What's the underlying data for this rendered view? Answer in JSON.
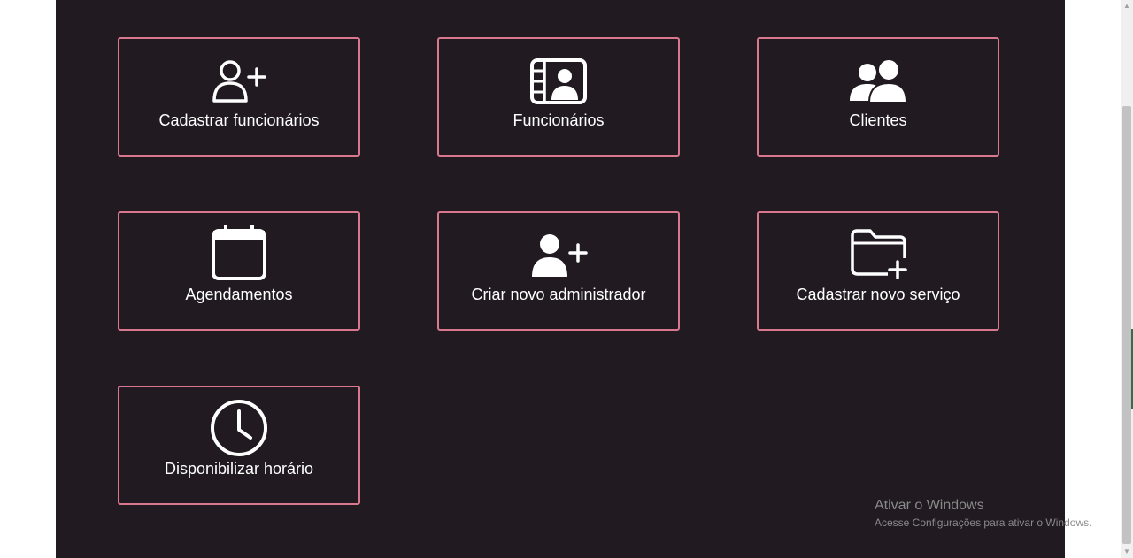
{
  "cards": [
    {
      "label": "Cadastrar funcionários",
      "icon": "user-plus-outline-icon"
    },
    {
      "label": "Funcionários",
      "icon": "id-card-icon"
    },
    {
      "label": "Clientes",
      "icon": "users-icon"
    },
    {
      "label": "Agendamentos",
      "icon": "calendar-icon"
    },
    {
      "label": "Criar novo administrador",
      "icon": "user-plus-icon"
    },
    {
      "label": "Cadastrar novo serviço",
      "icon": "folder-plus-icon"
    },
    {
      "label": "Disponibilizar horário",
      "icon": "clock-icon"
    }
  ],
  "watermark": {
    "title": "Ativar o Windows",
    "subtitle": "Acesse Configurações para ativar o Windows."
  },
  "colors": {
    "background": "#211a20",
    "card_border": "#d9778e",
    "text": "#ffffff"
  }
}
